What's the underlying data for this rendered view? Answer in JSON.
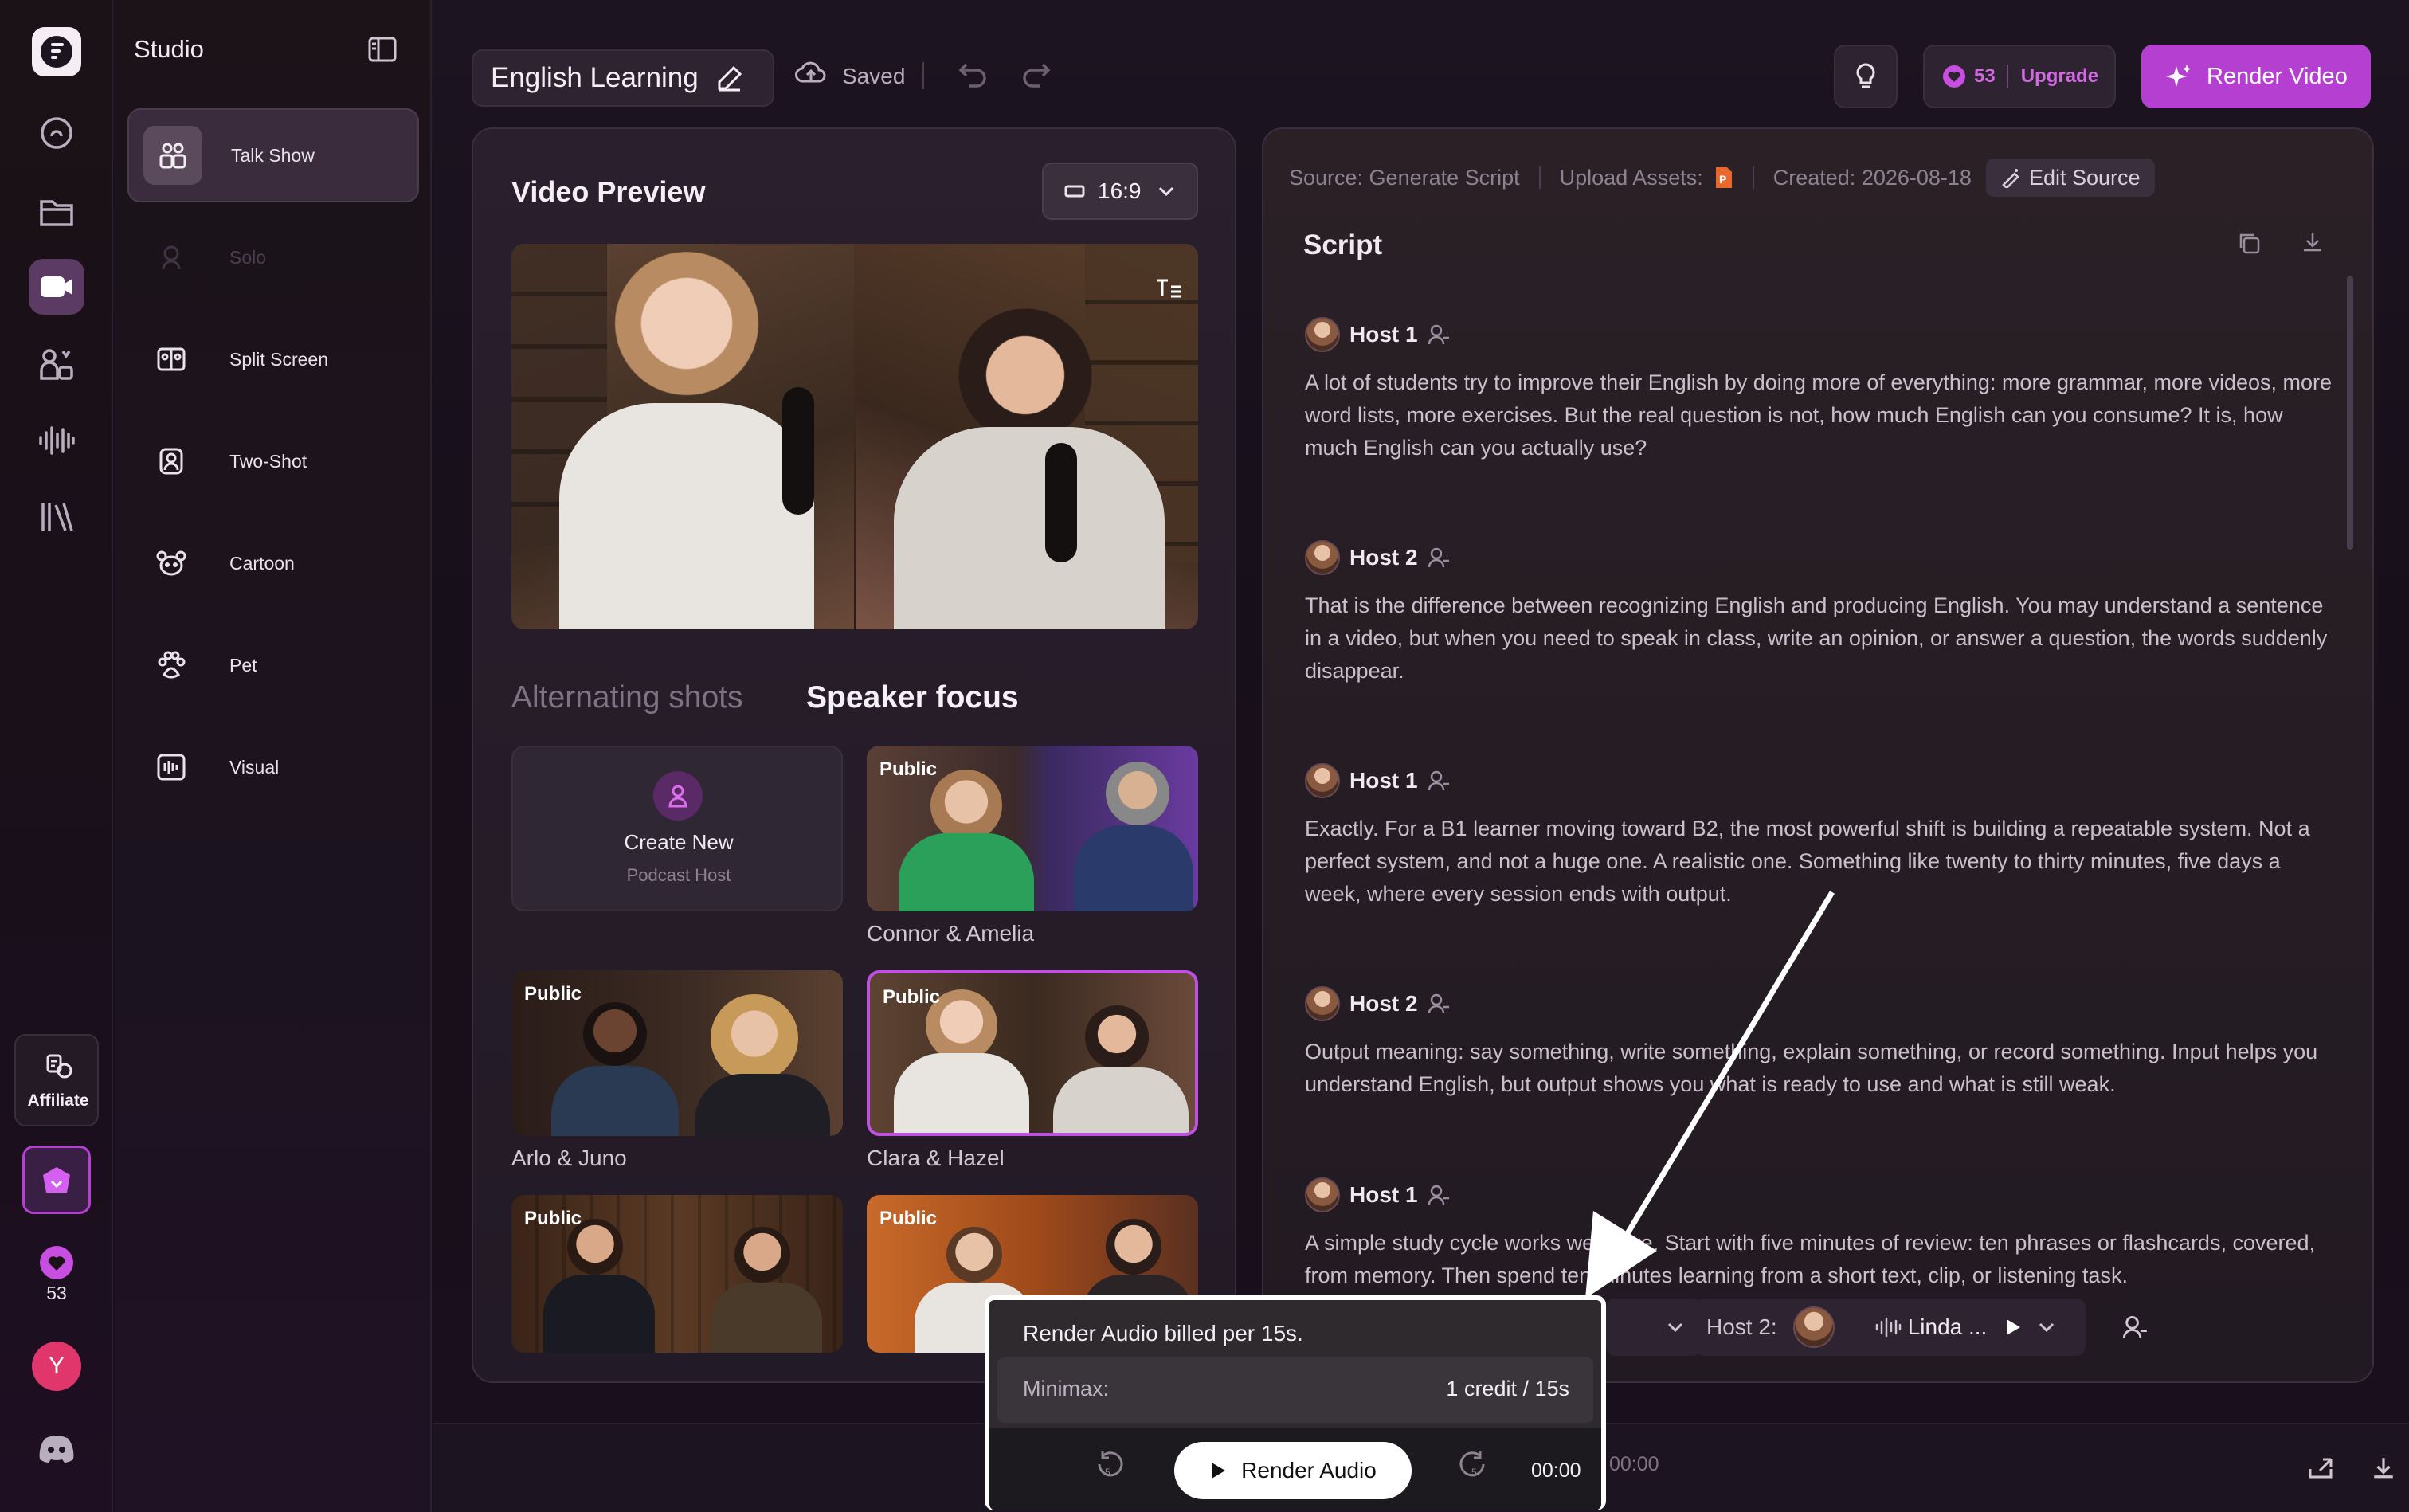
{
  "app": {
    "section_title": "Studio"
  },
  "rail": {
    "affiliate_label": "Affiliate",
    "credits": "53",
    "user_initial": "Y"
  },
  "categories": [
    {
      "label": "Talk Show",
      "icon": "users-icon",
      "active": true
    },
    {
      "label": "Solo",
      "icon": "person-icon",
      "disabled": true
    },
    {
      "label": "Split Screen",
      "icon": "split-screen-icon"
    },
    {
      "label": "Two-Shot",
      "icon": "two-shot-icon"
    },
    {
      "label": "Cartoon",
      "icon": "cartoon-icon"
    },
    {
      "label": "Pet",
      "icon": "paw-icon"
    },
    {
      "label": "Visual",
      "icon": "visual-icon"
    }
  ],
  "topbar": {
    "project_title": "English Learning",
    "saved_label": "Saved",
    "credits": "53",
    "upgrade_label": "Upgrade",
    "render_video_label": "Render Video"
  },
  "video_panel": {
    "title": "Video Preview",
    "aspect": "16:9",
    "tab_alternating": "Alternating shots",
    "tab_speaker_focus": "Speaker focus",
    "create_new_title": "Create New",
    "create_new_subtitle": "Podcast Host",
    "public_badge": "Public",
    "hosts": [
      {
        "name": "Connor & Amelia"
      },
      {
        "name": "Arlo & Juno"
      },
      {
        "name": "Clara & Hazel",
        "selected": true
      },
      {
        "name": ""
      },
      {
        "name": ""
      }
    ]
  },
  "script_panel": {
    "source_label": "Source: Generate Script",
    "upload_label": "Upload Assets:",
    "created_label": "Created: 2026-08-18",
    "edit_source_label": "Edit Source",
    "title": "Script",
    "entries": [
      {
        "host": "Host 1",
        "text": "A lot of students try to improve their English by doing more of everything: more grammar, more videos, more word lists, more exercises. But the real question is not, how much English can you consume? It is, how much English can you actually use?"
      },
      {
        "host": "Host 2",
        "text": "That is the difference between recognizing English and producing English. You may understand a sentence in a video, but when you need to speak in class, write an opinion, or answer a question, the words suddenly disappear."
      },
      {
        "host": "Host 1",
        "text": "Exactly. For a B1 learner moving toward B2, the most powerful shift is building a repeatable system. Not a perfect system, and not a huge one. A realistic one. Something like twenty to thirty minutes, five days a week, where every session ends with output."
      },
      {
        "host": "Host 2",
        "text": "Output meaning: say something, write something, explain something, or record something. Input helps you understand English, but output shows you what is ready to use and what is still weak."
      },
      {
        "host": "Host 1",
        "text": "A simple study cycle works well here. Start with five minutes of review: ten phrases or flashcards, covered, from memory. Then spend ten minutes learning from a short text, clip, or listening task."
      }
    ],
    "voice_host2_label": "Host 2:",
    "voice_host2_name": "Linda ..."
  },
  "popover": {
    "message": "Render Audio billed per 15s.",
    "provider_label": "Minimax:",
    "provider_price": "1 credit / 15s"
  },
  "player": {
    "render_audio_label": "Render Audio",
    "current_time": "00:00",
    "total_time": "00:00",
    "skip_seconds": "5"
  },
  "colors": {
    "accent": "#b43fd0",
    "upgrade": "#d06ae0",
    "background": "#1c1420"
  }
}
